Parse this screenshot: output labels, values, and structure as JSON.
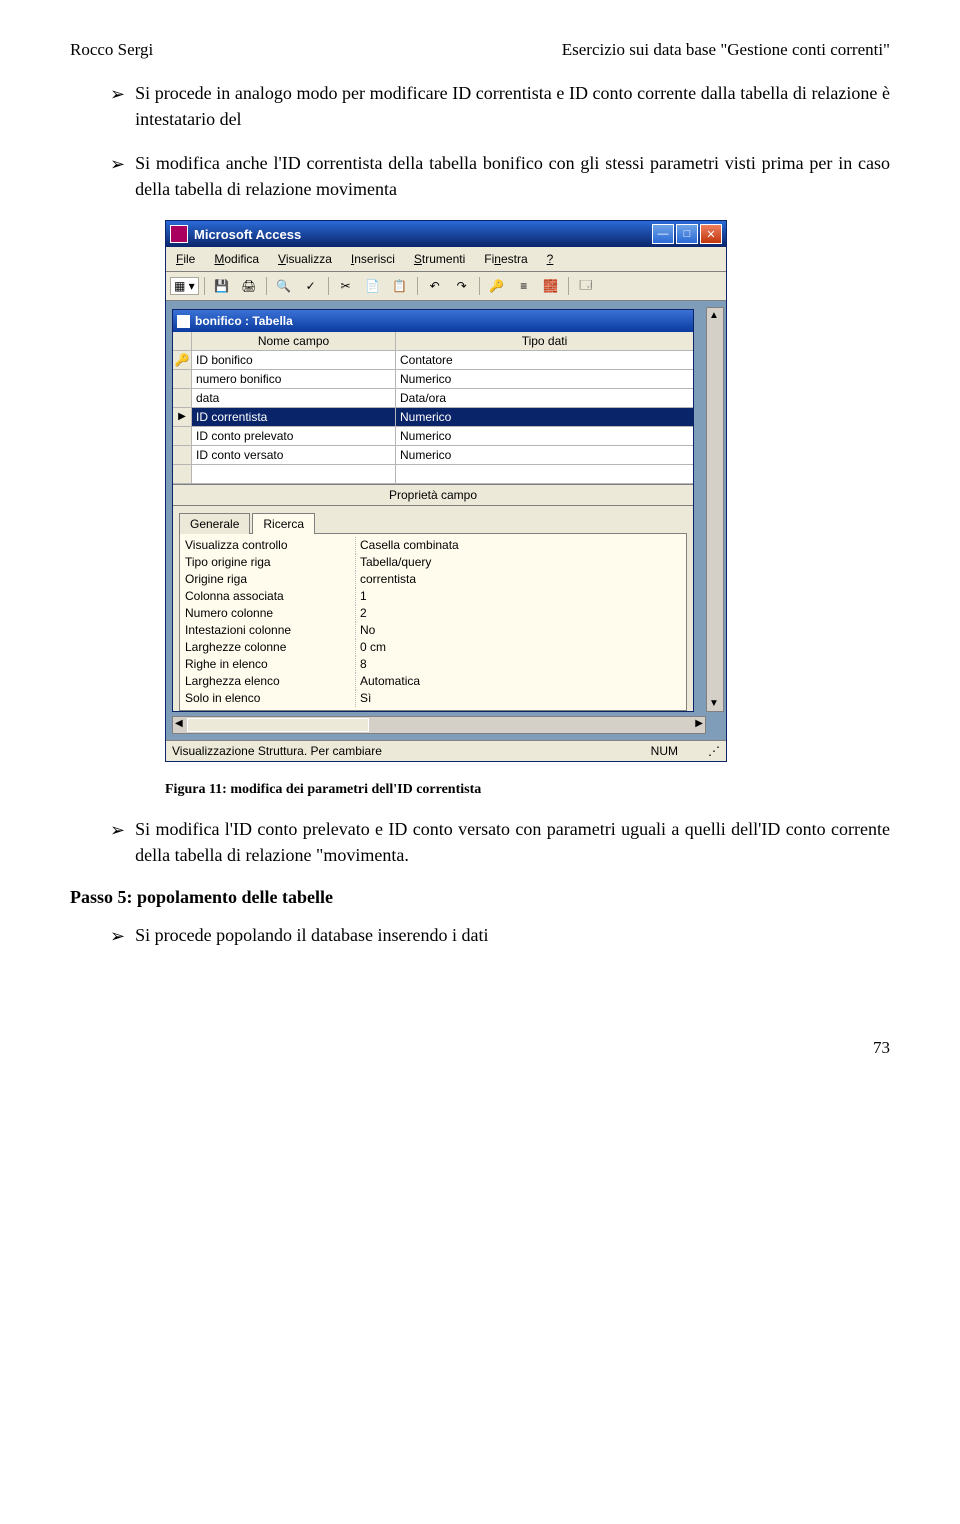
{
  "header": {
    "left": "Rocco Sergi",
    "right": "Esercizio sui data base \"Gestione conti correnti\""
  },
  "bullets_top": [
    "Si procede in analogo modo per modificare ID correntista e ID conto corrente dalla tabella di relazione è intestatario del",
    "Si modifica anche l'ID correntista della tabella bonifico con gli stessi parametri visti prima per in caso della tabella di relazione movimenta"
  ],
  "access": {
    "app_title": "Microsoft Access",
    "menus": [
      "File",
      "Modifica",
      "Visualizza",
      "Inserisci",
      "Strumenti",
      "Finestra",
      "?"
    ],
    "sub_title": "bonifico : Tabella",
    "grid_headers": {
      "field": "Nome campo",
      "type": "Tipo dati"
    },
    "fields": [
      {
        "name": "ID bonifico",
        "type": "Contatore",
        "pk": true
      },
      {
        "name": "numero bonifico",
        "type": "Numerico"
      },
      {
        "name": "data",
        "type": "Data/ora"
      },
      {
        "name": "ID correntista",
        "type": "Numerico",
        "selected": true
      },
      {
        "name": "ID conto prelevato",
        "type": "Numerico"
      },
      {
        "name": "ID conto versato",
        "type": "Numerico"
      }
    ],
    "properties_header": "Proprietà campo",
    "tabs": {
      "general": "Generale",
      "lookup": "Ricerca"
    },
    "properties": [
      {
        "label": "Visualizza controllo",
        "value": "Casella combinata"
      },
      {
        "label": "Tipo origine riga",
        "value": "Tabella/query"
      },
      {
        "label": "Origine riga",
        "value": "correntista"
      },
      {
        "label": "Colonna associata",
        "value": "1"
      },
      {
        "label": "Numero colonne",
        "value": "2"
      },
      {
        "label": "Intestazioni colonne",
        "value": "No"
      },
      {
        "label": "Larghezze colonne",
        "value": "0 cm"
      },
      {
        "label": "Righe in elenco",
        "value": "8"
      },
      {
        "label": "Larghezza elenco",
        "value": "Automatica"
      },
      {
        "label": "Solo in elenco",
        "value": "Sì"
      }
    ],
    "status_left": "Visualizzazione Struttura. Per cambiare",
    "status_num": "NUM"
  },
  "caption": "Figura 11: modifica dei parametri dell'ID correntista",
  "bullets_bottom": [
    "Si modifica l'ID conto prelevato e ID conto versato con parametri uguali a quelli dell'ID conto corrente della tabella di relazione \"movimenta."
  ],
  "section_title": "Passo 5: popolamento delle tabelle",
  "bullets_section": [
    "Si procede popolando il database inserendo i dati"
  ],
  "page_number": "73"
}
